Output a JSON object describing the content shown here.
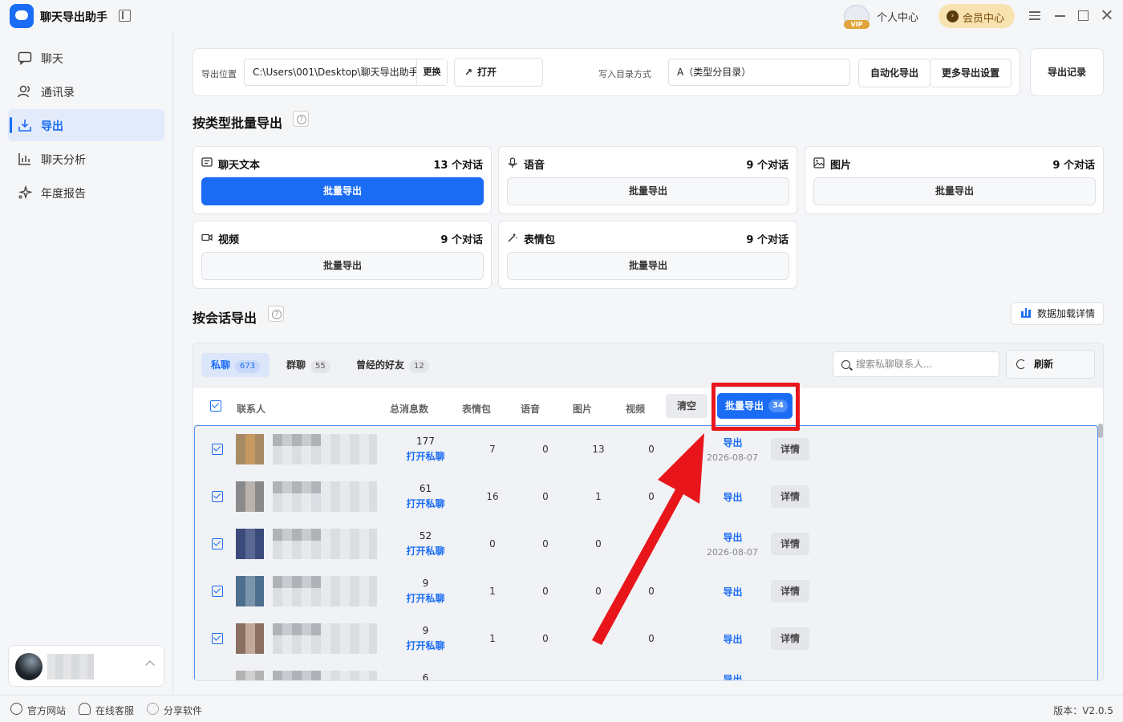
{
  "app": {
    "title": "聊天导出助手"
  },
  "header": {
    "vip_tag": "VIP",
    "personal_center": "个人中心",
    "member_center": "会员中心"
  },
  "sidebar": {
    "items": [
      {
        "label": "聊天",
        "icon": "chat-icon"
      },
      {
        "label": "通讯录",
        "icon": "contacts-icon"
      },
      {
        "label": "导出",
        "icon": "export-icon",
        "active": true
      },
      {
        "label": "聊天分析",
        "icon": "chart-icon"
      },
      {
        "label": "年度报告",
        "icon": "sparkle-icon"
      }
    ]
  },
  "toolbar": {
    "export_location_label": "导出位置",
    "export_path": "C:\\Users\\001\\Desktop\\聊天导出助手",
    "change_label": "更换",
    "open_label": "打开",
    "dir_mode_label": "写入目录方式",
    "dir_mode_value": "A（类型分目录）",
    "auto_export_label": "自动化导出",
    "more_settings_label": "更多导出设置",
    "export_records_label": "导出记录"
  },
  "batch_by_type": {
    "title": "按类型批量导出",
    "cards": [
      {
        "name": "聊天文本",
        "count": "13 个对话",
        "button": "批量导出",
        "primary": true
      },
      {
        "name": "语音",
        "count": "9 个对话",
        "button": "批量导出"
      },
      {
        "name": "图片",
        "count": "9 个对话",
        "button": "批量导出"
      },
      {
        "name": "视频",
        "count": "9 个对话",
        "button": "批量导出"
      },
      {
        "name": "表情包",
        "count": "9 个对话",
        "button": "批量导出"
      }
    ]
  },
  "by_session": {
    "title": "按会话导出",
    "data_details_label": "数据加载详情",
    "tabs": [
      {
        "label": "私聊",
        "count": "673"
      },
      {
        "label": "群聊",
        "count": "55"
      },
      {
        "label": "曾经的好友",
        "count": "12"
      }
    ],
    "search_placeholder": "搜索私聊联系人...",
    "refresh_label": "刷新",
    "columns": [
      "联系人",
      "总消息数",
      "表情包",
      "语音",
      "图片",
      "视频"
    ],
    "clear_label": "清空",
    "batch_export_label": "批量导出",
    "batch_export_count": "34",
    "open_chat_label": "打开私聊",
    "export_label": "导出",
    "detail_label": "详情",
    "rows": [
      {
        "total": "177",
        "sticker": "7",
        "voice": "0",
        "image": "13",
        "video": "0",
        "date": "2026-08-07"
      },
      {
        "total": "61",
        "sticker": "16",
        "voice": "0",
        "image": "1",
        "video": "0",
        "date": ""
      },
      {
        "total": "52",
        "sticker": "0",
        "voice": "0",
        "image": "0",
        "video": "0",
        "date": "2026-08-07"
      },
      {
        "total": "9",
        "sticker": "1",
        "voice": "0",
        "image": "0",
        "video": "0",
        "date": ""
      },
      {
        "total": "9",
        "sticker": "1",
        "voice": "0",
        "image": "0",
        "video": "0",
        "date": ""
      },
      {
        "total": "6",
        "sticker": "",
        "voice": "",
        "image": "",
        "video": "",
        "date": ""
      }
    ]
  },
  "footer": {
    "website": "官方网站",
    "support": "在线客服",
    "share": "分享软件",
    "version": "版本：V2.0.5"
  },
  "colors": {
    "accent": "#1a6cf5",
    "highlight": "#e8161b"
  }
}
